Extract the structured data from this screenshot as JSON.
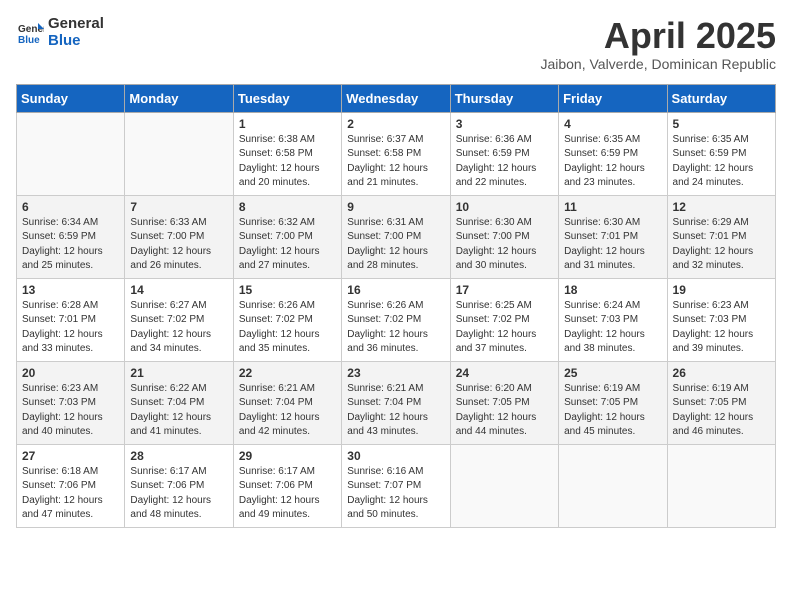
{
  "logo": {
    "general": "General",
    "blue": "Blue"
  },
  "title": {
    "month_year": "April 2025",
    "location": "Jaibon, Valverde, Dominican Republic"
  },
  "days_of_week": [
    "Sunday",
    "Monday",
    "Tuesday",
    "Wednesday",
    "Thursday",
    "Friday",
    "Saturday"
  ],
  "weeks": [
    [
      {
        "day": "",
        "info": ""
      },
      {
        "day": "",
        "info": ""
      },
      {
        "day": "1",
        "info": "Sunrise: 6:38 AM\nSunset: 6:58 PM\nDaylight: 12 hours\nand 20 minutes."
      },
      {
        "day": "2",
        "info": "Sunrise: 6:37 AM\nSunset: 6:58 PM\nDaylight: 12 hours\nand 21 minutes."
      },
      {
        "day": "3",
        "info": "Sunrise: 6:36 AM\nSunset: 6:59 PM\nDaylight: 12 hours\nand 22 minutes."
      },
      {
        "day": "4",
        "info": "Sunrise: 6:35 AM\nSunset: 6:59 PM\nDaylight: 12 hours\nand 23 minutes."
      },
      {
        "day": "5",
        "info": "Sunrise: 6:35 AM\nSunset: 6:59 PM\nDaylight: 12 hours\nand 24 minutes."
      }
    ],
    [
      {
        "day": "6",
        "info": "Sunrise: 6:34 AM\nSunset: 6:59 PM\nDaylight: 12 hours\nand 25 minutes."
      },
      {
        "day": "7",
        "info": "Sunrise: 6:33 AM\nSunset: 7:00 PM\nDaylight: 12 hours\nand 26 minutes."
      },
      {
        "day": "8",
        "info": "Sunrise: 6:32 AM\nSunset: 7:00 PM\nDaylight: 12 hours\nand 27 minutes."
      },
      {
        "day": "9",
        "info": "Sunrise: 6:31 AM\nSunset: 7:00 PM\nDaylight: 12 hours\nand 28 minutes."
      },
      {
        "day": "10",
        "info": "Sunrise: 6:30 AM\nSunset: 7:00 PM\nDaylight: 12 hours\nand 30 minutes."
      },
      {
        "day": "11",
        "info": "Sunrise: 6:30 AM\nSunset: 7:01 PM\nDaylight: 12 hours\nand 31 minutes."
      },
      {
        "day": "12",
        "info": "Sunrise: 6:29 AM\nSunset: 7:01 PM\nDaylight: 12 hours\nand 32 minutes."
      }
    ],
    [
      {
        "day": "13",
        "info": "Sunrise: 6:28 AM\nSunset: 7:01 PM\nDaylight: 12 hours\nand 33 minutes."
      },
      {
        "day": "14",
        "info": "Sunrise: 6:27 AM\nSunset: 7:02 PM\nDaylight: 12 hours\nand 34 minutes."
      },
      {
        "day": "15",
        "info": "Sunrise: 6:26 AM\nSunset: 7:02 PM\nDaylight: 12 hours\nand 35 minutes."
      },
      {
        "day": "16",
        "info": "Sunrise: 6:26 AM\nSunset: 7:02 PM\nDaylight: 12 hours\nand 36 minutes."
      },
      {
        "day": "17",
        "info": "Sunrise: 6:25 AM\nSunset: 7:02 PM\nDaylight: 12 hours\nand 37 minutes."
      },
      {
        "day": "18",
        "info": "Sunrise: 6:24 AM\nSunset: 7:03 PM\nDaylight: 12 hours\nand 38 minutes."
      },
      {
        "day": "19",
        "info": "Sunrise: 6:23 AM\nSunset: 7:03 PM\nDaylight: 12 hours\nand 39 minutes."
      }
    ],
    [
      {
        "day": "20",
        "info": "Sunrise: 6:23 AM\nSunset: 7:03 PM\nDaylight: 12 hours\nand 40 minutes."
      },
      {
        "day": "21",
        "info": "Sunrise: 6:22 AM\nSunset: 7:04 PM\nDaylight: 12 hours\nand 41 minutes."
      },
      {
        "day": "22",
        "info": "Sunrise: 6:21 AM\nSunset: 7:04 PM\nDaylight: 12 hours\nand 42 minutes."
      },
      {
        "day": "23",
        "info": "Sunrise: 6:21 AM\nSunset: 7:04 PM\nDaylight: 12 hours\nand 43 minutes."
      },
      {
        "day": "24",
        "info": "Sunrise: 6:20 AM\nSunset: 7:05 PM\nDaylight: 12 hours\nand 44 minutes."
      },
      {
        "day": "25",
        "info": "Sunrise: 6:19 AM\nSunset: 7:05 PM\nDaylight: 12 hours\nand 45 minutes."
      },
      {
        "day": "26",
        "info": "Sunrise: 6:19 AM\nSunset: 7:05 PM\nDaylight: 12 hours\nand 46 minutes."
      }
    ],
    [
      {
        "day": "27",
        "info": "Sunrise: 6:18 AM\nSunset: 7:06 PM\nDaylight: 12 hours\nand 47 minutes."
      },
      {
        "day": "28",
        "info": "Sunrise: 6:17 AM\nSunset: 7:06 PM\nDaylight: 12 hours\nand 48 minutes."
      },
      {
        "day": "29",
        "info": "Sunrise: 6:17 AM\nSunset: 7:06 PM\nDaylight: 12 hours\nand 49 minutes."
      },
      {
        "day": "30",
        "info": "Sunrise: 6:16 AM\nSunset: 7:07 PM\nDaylight: 12 hours\nand 50 minutes."
      },
      {
        "day": "",
        "info": ""
      },
      {
        "day": "",
        "info": ""
      },
      {
        "day": "",
        "info": ""
      }
    ]
  ]
}
